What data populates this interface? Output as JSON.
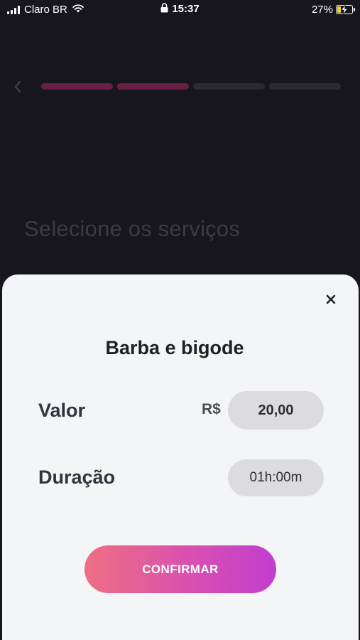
{
  "status_bar": {
    "carrier": "Claro BR",
    "time": "15:37",
    "battery_percent": "27%",
    "battery_level": 0.27,
    "icons": [
      "signal-icon",
      "wifi-icon",
      "lock-icon",
      "battery-charging-icon"
    ]
  },
  "background": {
    "heading": "Selecione os serviços",
    "progress": {
      "total_steps": 4,
      "completed_steps": 2
    },
    "colors": {
      "progress_active": "#6a1f45",
      "progress_inactive": "#2a2a30"
    }
  },
  "sheet": {
    "title": "Barba e bigode",
    "value_label": "Valor",
    "currency": "R$",
    "price": "20,00",
    "duration_label": "Duração",
    "duration": "01h:00m",
    "confirm_label": "CONFIRMAR",
    "colors": {
      "gradient_start": "#ee6f83",
      "gradient_end": "#c13dd0",
      "sheet_bg": "#f4f5f7"
    }
  }
}
